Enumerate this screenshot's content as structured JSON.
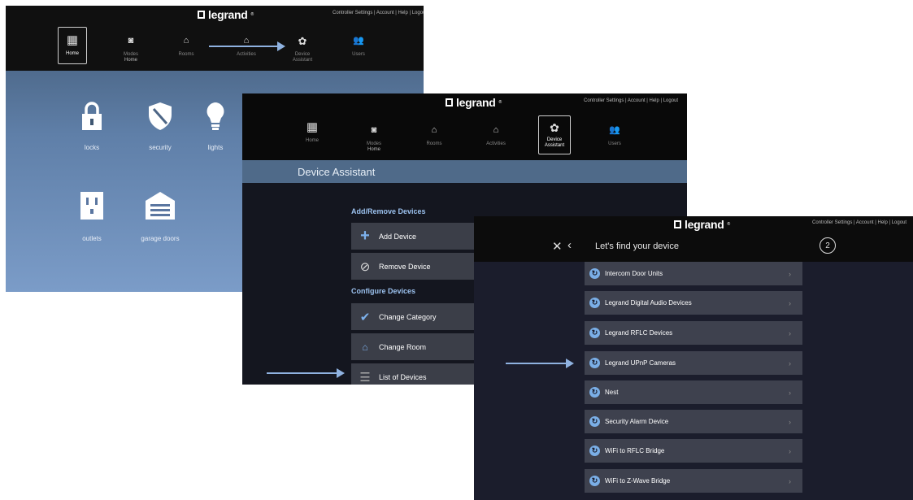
{
  "brand": "legrand",
  "top_links": "Controller Settings | Account | Help | Logout",
  "nav": {
    "home": "Home",
    "modes": "Modes",
    "modes_sub": "Home",
    "rooms": "Rooms",
    "activities": "Activities",
    "device_assistant": "Device Assistant",
    "users": "Users"
  },
  "home_tiles": [
    "locks",
    "security",
    "lights",
    "outlets",
    "garage doors"
  ],
  "device_assistant": {
    "title": "Device Assistant",
    "section_add_remove": "Add/Remove Devices",
    "add_device": "Add Device",
    "remove_device": "Remove Device",
    "section_configure": "Configure Devices",
    "change_category": "Change Category",
    "change_room": "Change Room",
    "list_of_devices": "List of Devices"
  },
  "find_device": {
    "title": "Let's find your device",
    "step": "2",
    "items": [
      "Intercom Door Units",
      "Legrand Digital Audio Devices",
      "Legrand RFLC Devices",
      "Legrand UPnP Cameras",
      "Nest",
      "Security Alarm Device",
      "WiFi to RFLC Bridge",
      "WiFi to Z-Wave Bridge"
    ]
  },
  "icons": {
    "home": "grid-icon",
    "modes": "modes-icon",
    "rooms": "house-icon",
    "activities": "activities-icon",
    "device_assistant": "gear-icon",
    "users": "users-icon",
    "back": "chevron-left-icon",
    "close": "close-icon"
  },
  "colors": {
    "accent": "#7db1ec",
    "titlebar": "#4f6a89",
    "row": "#3e414e",
    "arrow": "#8fb2e0"
  }
}
